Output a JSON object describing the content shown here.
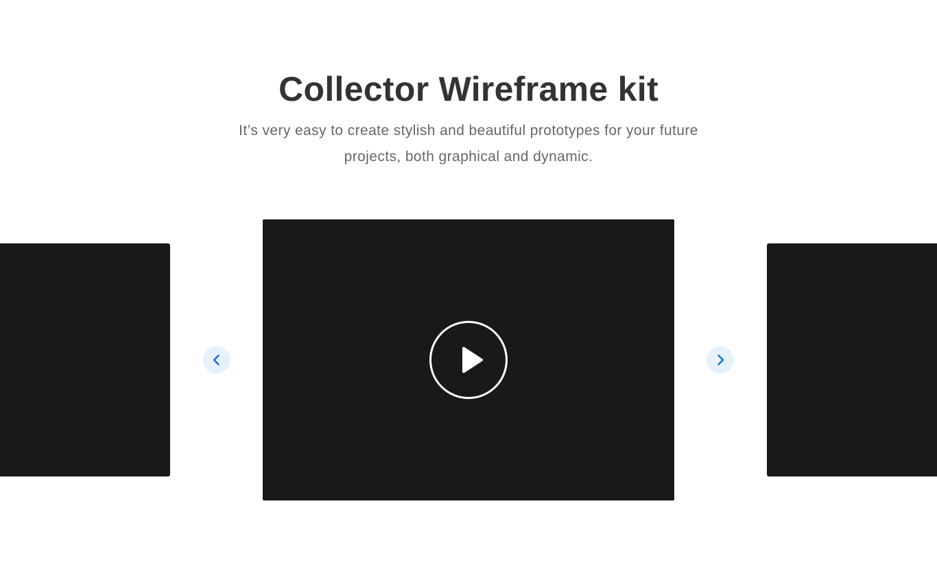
{
  "header": {
    "title": "Collector Wireframe kit",
    "subtitle": "It’s very easy to create stylish and beautiful prototypes for your future projects, both graphical and dynamic."
  },
  "carousel": {
    "slide_color": "#191919",
    "arrow_bg_color": "#e6f1fc",
    "arrow_color": "#0a72d9",
    "prev_icon": "chevron-left-icon",
    "next_icon": "chevron-right-icon",
    "play_icon": "play-icon"
  }
}
